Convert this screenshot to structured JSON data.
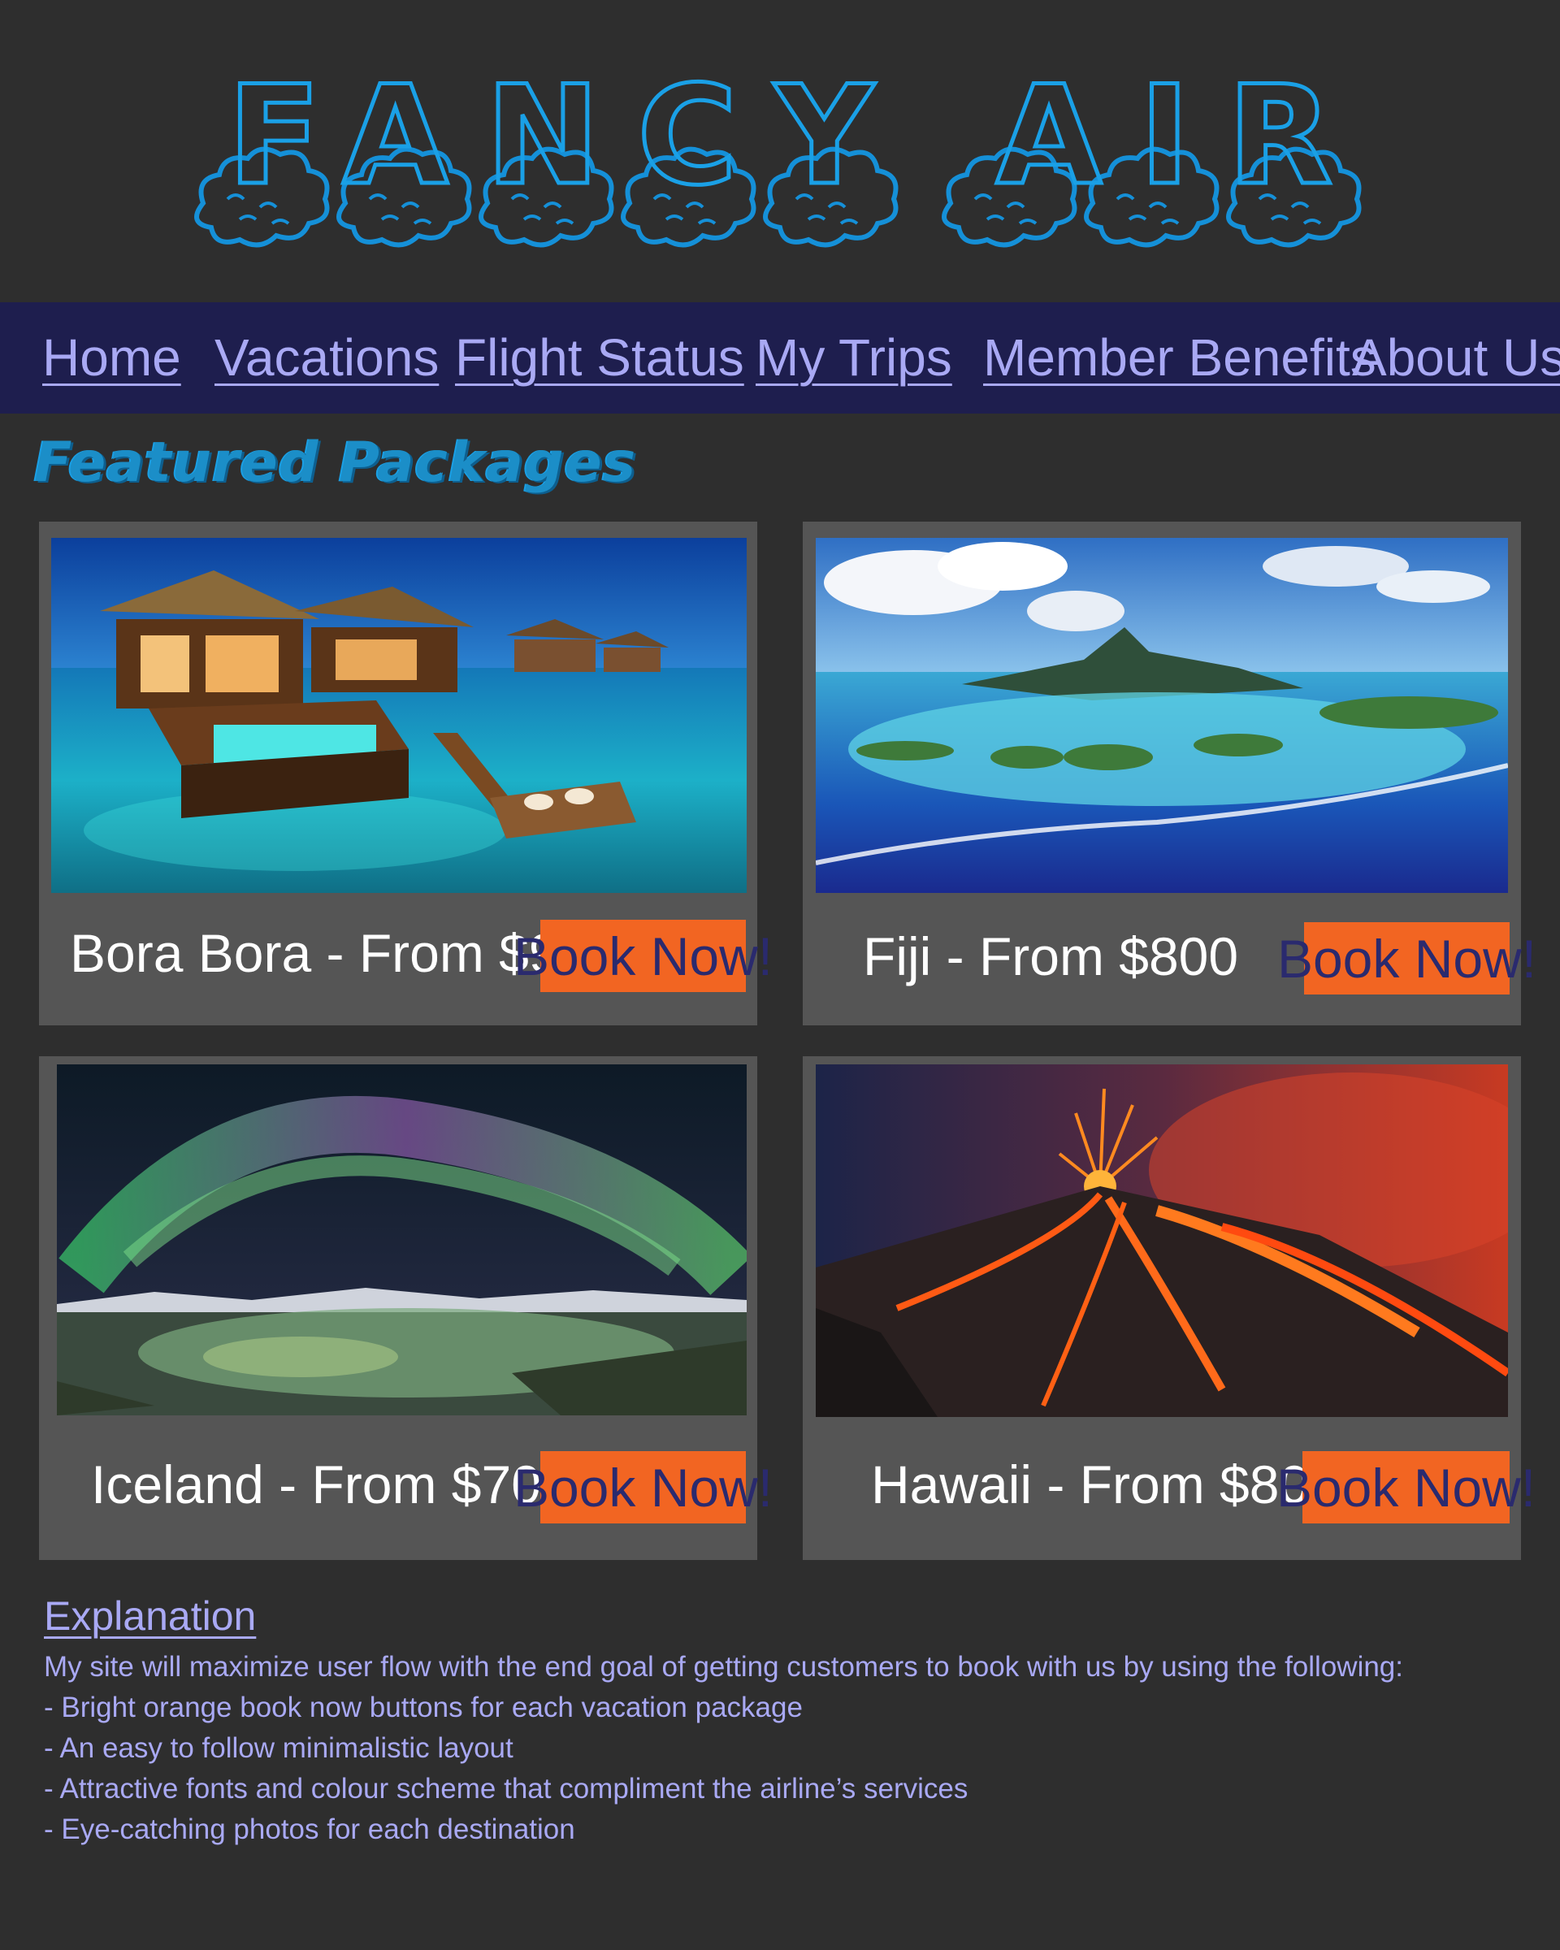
{
  "brand": {
    "logo_text": "FANCY AIR",
    "logo_color": "#1aa0e6"
  },
  "nav": {
    "items": [
      {
        "label": "Home"
      },
      {
        "label": "Vacations"
      },
      {
        "label": "Flight Status"
      },
      {
        "label": "My Trips"
      },
      {
        "label": "Member Benefits"
      },
      {
        "label": "About Us"
      }
    ],
    "background": "#1e1e4e",
    "link_color": "#a9a9f4"
  },
  "featured": {
    "heading": "Featured Packages",
    "packages": [
      {
        "title": "Bora Bora - From $900",
        "button": "Book Now!",
        "photo": "overwater-bungalows-photo"
      },
      {
        "title": "Fiji - From $800",
        "button": "Book Now!",
        "photo": "island-lagoon-photo"
      },
      {
        "title": "Iceland - From $700",
        "button": "Book Now!",
        "photo": "aurora-lake-photo"
      },
      {
        "title": "Hawaii - From $800",
        "button": "Book Now!",
        "photo": "volcano-lava-photo"
      }
    ],
    "button_color": "#f26522",
    "button_text_color": "#2a2a6e",
    "card_color": "#555555"
  },
  "explanation": {
    "heading": "Explanation",
    "lines": [
      "My site will maximize user flow with the end goal of getting customers to book with us by using the following:",
      "- Bright orange book now buttons for each vacation package",
      "- An easy to follow minimalistic layout",
      "- Attractive fonts and colour scheme that compliment the airline’s services",
      "- Eye-catching photos for each destination"
    ]
  }
}
